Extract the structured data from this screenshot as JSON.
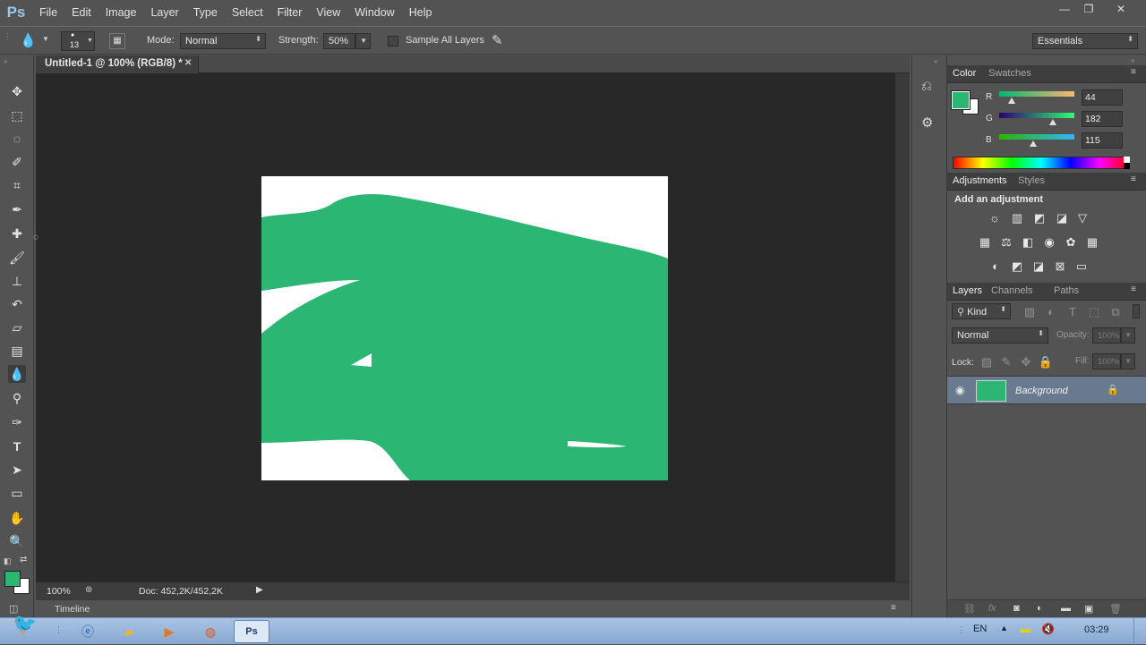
{
  "app": {
    "logo": "Ps"
  },
  "menu": [
    "File",
    "Edit",
    "Image",
    "Layer",
    "Type",
    "Select",
    "Filter",
    "View",
    "Window",
    "Help"
  ],
  "window_controls": {
    "minimize": "—",
    "restore": "❐",
    "close": "✕"
  },
  "options": {
    "brush_size": "13",
    "mode_label": "Mode:",
    "mode_value": "Normal",
    "strength_label": "Strength:",
    "strength_value": "50%",
    "sample_all_layers": "Sample All Layers",
    "sample_all_checked": false,
    "workspace": "Essentials"
  },
  "tools": [
    "move-icon",
    "marquee-icon",
    "lasso-icon",
    "quick-select-icon",
    "crop-icon",
    "eyedropper-icon",
    "healing-icon",
    "brush-icon",
    "stamp-icon",
    "history-brush-icon",
    "eraser-icon",
    "gradient-icon",
    "blur-icon",
    "dodge-icon",
    "pen-icon",
    "type-icon",
    "path-select-icon",
    "rectangle-icon",
    "hand-icon",
    "zoom-icon"
  ],
  "active_tool": "blur-icon",
  "document": {
    "tab_title": "Untitled-1 @ 100% (RGB/8) *",
    "zoom": "100%",
    "doc_size": "Doc: 452,2K/452,2K",
    "timeline_label": "Timeline"
  },
  "color_panel": {
    "tabs": [
      "Color",
      "Swatches"
    ],
    "foreground": "#2cb673",
    "background": "#ffffff",
    "r_label": "R",
    "g_label": "G",
    "b_label": "B",
    "r": "44",
    "g": "182",
    "b": "115"
  },
  "adjustments_panel": {
    "tabs": [
      "Adjustments",
      "Styles"
    ],
    "heading": "Add an adjustment"
  },
  "layers_panel": {
    "tabs": [
      "Layers",
      "Channels",
      "Paths"
    ],
    "filter_kind": "Kind",
    "blend_mode": "Normal",
    "opacity_label": "Opacity:",
    "opacity_value": "100%",
    "lock_label": "Lock:",
    "fill_label": "Fill:",
    "fill_value": "100%",
    "layers": [
      {
        "name": "Background",
        "visible": true,
        "locked": true
      }
    ]
  },
  "taskbar": {
    "language": "EN",
    "time": "03:29"
  },
  "colors": {
    "accent_green": "#2cb673",
    "canvas_bg": "#282828",
    "ui_gray": "#535353"
  }
}
